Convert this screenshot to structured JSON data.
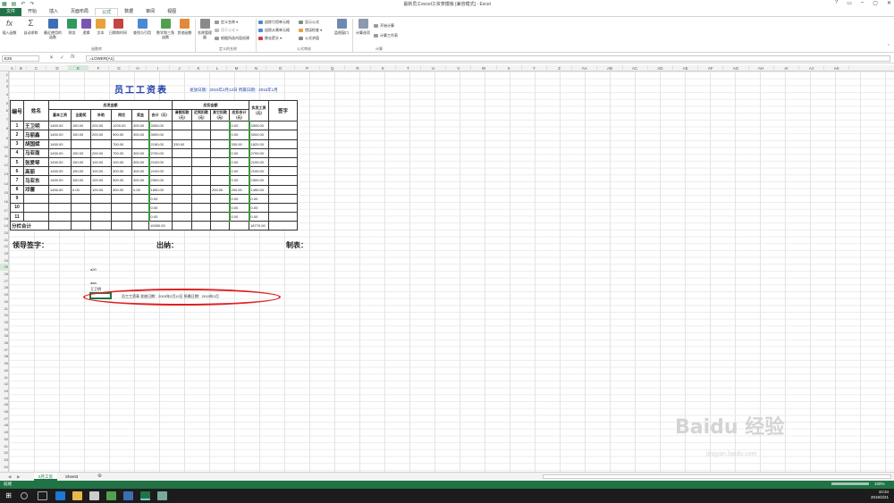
{
  "window": {
    "title": "最新员工excel工资表模板  [兼容模式] - Excel",
    "controls": [
      "?",
      "▭",
      "–",
      "▢",
      "✕"
    ]
  },
  "ribbon_tabs": [
    "文件",
    "开始",
    "插入",
    "页面布局",
    "公式",
    "数据",
    "审阅",
    "视图"
  ],
  "active_tab": "公式",
  "ribbon": {
    "function_library": [
      "插入函数",
      "自动求和",
      "最近使用的函数",
      "财务",
      "逻辑",
      "文本",
      "日期和时间",
      "查找与引用",
      "数学和三角函数",
      "其他函数"
    ],
    "function_library_label": "函数库",
    "defined_names": {
      "big": "名称管理器",
      "items": [
        "定义名称 ▾",
        "用于公式 ▾",
        "根据所选内容创建"
      ],
      "label": "定义的名称"
    },
    "formula_auditing": {
      "items": [
        "追踪引用单元格",
        "追踪从属单元格",
        "移去箭头 ▾",
        "显示公式",
        "错误检查 ▾",
        "公式求值"
      ],
      "watch": "监视窗口",
      "label": "公式审核"
    },
    "calculation": {
      "options": "计算选项",
      "items": [
        "开始计算",
        "计算工作表"
      ],
      "label": "计算"
    }
  },
  "formula_bar": {
    "name_box": "E25",
    "formula": "=LOWER(A1)"
  },
  "columns": [
    "A",
    "B",
    "C",
    "D",
    "E",
    "F",
    "G",
    "H",
    "I",
    "J",
    "K",
    "L",
    "M",
    "N",
    "O",
    "P",
    "Q",
    "R",
    "S",
    "T",
    "U",
    "V",
    "W",
    "X",
    "Y",
    "Z",
    "AA",
    "AB",
    "AC",
    "AD",
    "AE",
    "AF",
    "AG",
    "AH",
    "AI",
    "AJ",
    "AK"
  ],
  "rows": [
    "1",
    "2",
    "3",
    "4",
    "5",
    "6",
    "7",
    "8",
    "9",
    "10",
    "11",
    "12",
    "13",
    "14",
    "15",
    "16",
    "17",
    "18",
    "19",
    "20",
    "21",
    "22",
    "23",
    "24",
    "25",
    "26",
    "27",
    "28",
    "29",
    "30",
    "31",
    "32",
    "33",
    "34",
    "35",
    "36",
    "37",
    "38",
    "39",
    "40",
    "41",
    "42",
    "43",
    "44",
    "45",
    "46",
    "47",
    "48",
    "49",
    "50",
    "51",
    "52",
    "53",
    "54",
    "55",
    "56",
    "57",
    "58"
  ],
  "sheet": {
    "title": "员工工资表",
    "subtitle": "发放日期：2015年2月12日  所属日期：2015年1月",
    "header": {
      "no": "编号",
      "name": "姓名",
      "payable": "应发金额",
      "deduct": "应扣金额",
      "net": "实发工资（元）",
      "sign": "签字",
      "sub": [
        "基本工资",
        "全勤奖",
        "补助",
        "岗位",
        "奖金",
        "合计（元）",
        "请假扣款（元）",
        "迟到扣款（元）",
        "其它扣款（元）",
        "应扣合计（元）"
      ]
    },
    "rows": [
      [
        "1",
        "王卫明",
        "1450.00",
        "150.00",
        "200.00",
        "1200.00",
        "300.00",
        "3300.00",
        "",
        "",
        "",
        "0.00",
        "3300.00"
      ],
      [
        "2",
        "马丽鑫",
        "1450.00",
        "150.00",
        "200.00",
        "900.00",
        "300.00",
        "3000.00",
        "",
        "",
        "",
        "0.00",
        "3000.00"
      ],
      [
        "3",
        "胡国斌",
        "1450.00",
        "",
        "",
        "700.00",
        "",
        "2150.00",
        "330.00",
        "",
        "",
        "330.00",
        "1820.00"
      ],
      [
        "4",
        "马亚南",
        "1450.00",
        "150.00",
        "200.00",
        "700.00",
        "300.00",
        "2700.00",
        "",
        "",
        "",
        "0.00",
        "2700.00"
      ],
      [
        "5",
        "张爱琴",
        "1450.00",
        "150.00",
        "100.00",
        "100.00",
        "300.00",
        "2100.00",
        "",
        "",
        "",
        "0.00",
        "2100.00"
      ],
      [
        "6",
        "高丽",
        "1450.00",
        "150.00",
        "100.00",
        "300.00",
        "300.00",
        "2100.00",
        "",
        "",
        "",
        "0.00",
        "2100.00"
      ],
      [
        "7",
        "马亚东",
        "1450.00",
        "150.00",
        "100.00",
        "300.00",
        "300.00",
        "2300.00",
        "",
        "",
        "",
        "0.00",
        "2300.00"
      ],
      [
        "8",
        "邓蕾",
        "1450.00",
        "0.00",
        "100.00",
        "300.00",
        "0.00",
        "1650.00",
        "",
        "",
        "200.00",
        "200.00",
        "1450.00"
      ],
      [
        "9",
        "",
        "",
        "",
        "",
        "",
        "",
        "0.00",
        "",
        "",
        "",
        "0.00",
        "0.00"
      ],
      [
        "10",
        "",
        "",
        "",
        "",
        "",
        "",
        "0.00",
        "",
        "",
        "",
        "0.00",
        "0.00"
      ],
      [
        "11",
        "",
        "",
        "",
        "",
        "",
        "",
        "0.00",
        "",
        "",
        "",
        "0.00",
        "0.00"
      ]
    ],
    "subtotal": {
      "label": "分栏合计",
      "total": "19300.00",
      "net": "18770.00"
    },
    "signatures": [
      "领导签字：",
      "出纳：",
      "制表："
    ],
    "extra_cells": {
      "a20": "a20",
      "aaa": "aaa",
      "wang": "王卫明",
      "formula_text": "员工工资表  发放日期：2015年2月12日  所属日期：2015年1月"
    }
  },
  "sheet_tabs": [
    "5月工资",
    "Sheet3"
  ],
  "active_sheet": "5月工资",
  "status": {
    "left": "就绪",
    "zoom": "100%"
  },
  "taskbar": {
    "time": "10:34",
    "date": "2016/2/21"
  },
  "watermark": {
    "logo": "Baidu 经验",
    "url": "jingyan.baidu.com"
  },
  "colors": {
    "excel_green": "#217346",
    "title_blue": "#1f3ea8",
    "annotation_red": "#e02020"
  }
}
